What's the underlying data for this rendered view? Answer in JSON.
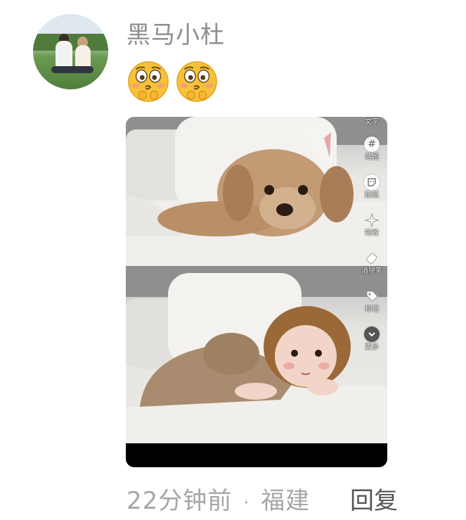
{
  "comment": {
    "username": "黑马小杜",
    "emoji_names": [
      "shy-face-emoji",
      "shy-face-emoji"
    ],
    "time": "22分钟前",
    "separator": "·",
    "location": "福建",
    "reply_label": "回复"
  },
  "image_editor": {
    "tools": [
      {
        "label": "文字",
        "icon": "text-icon"
      },
      {
        "label": "话题",
        "icon": "hashtag-icon"
      },
      {
        "label": "贴纸",
        "icon": "sticker-icon"
      },
      {
        "label": "特效",
        "icon": "sparkle-icon"
      },
      {
        "label": "消除笔",
        "icon": "eraser-icon"
      },
      {
        "label": "标记",
        "icon": "tag-icon"
      },
      {
        "label": "更多",
        "icon": "chevron-down-icon"
      }
    ],
    "hash_glyph": "#",
    "more_glyph": "⌄"
  },
  "colors": {
    "username": "#8e8e8e",
    "meta": "#a6a6a6",
    "reply": "#555555"
  }
}
